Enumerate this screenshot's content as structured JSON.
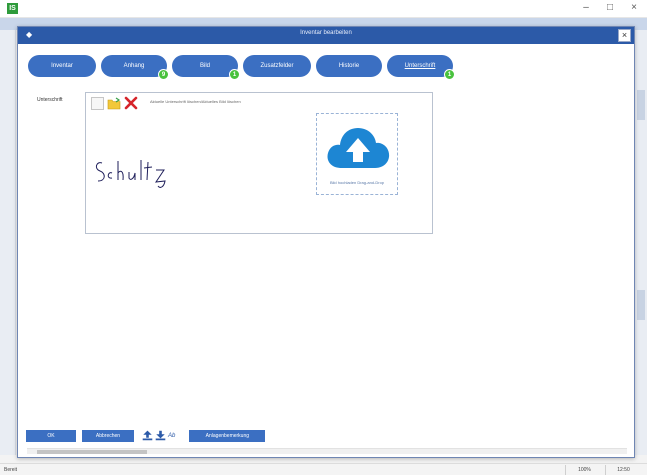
{
  "app": {
    "minimize": "–",
    "maximize": "□",
    "close": "×"
  },
  "dialog": {
    "title": "Inventar bearbeiten",
    "close": "×"
  },
  "tabs": [
    {
      "label": "Inventar",
      "badge": null,
      "active": false
    },
    {
      "label": "Anhang",
      "badge": "9",
      "active": false
    },
    {
      "label": "Bild",
      "badge": "1",
      "active": false
    },
    {
      "label": "Zusatzfelder",
      "badge": null,
      "active": false
    },
    {
      "label": "Historie",
      "badge": null,
      "active": false
    },
    {
      "label": "Unterschrift",
      "badge": "1",
      "active": true
    }
  ],
  "signature": {
    "field_label": "Unterschrift",
    "hint": "Aktuelle Unterschrift löschen/Aktuelles Bild löschen",
    "signature_text": "Schultz",
    "upload_caption": "Bild hochladen Drag-and-Drop"
  },
  "buttons": {
    "ok": "OK",
    "cancel": "Abbrechen",
    "extra": "Ab",
    "attachment": "Anlagenbemerkung"
  },
  "status": {
    "left": "Bereit",
    "zoom": "100%",
    "time": "12:50"
  },
  "colors": {
    "accent": "#3b6fc2",
    "titlebar": "#2c5aa8",
    "badge": "#49c23d",
    "delete": "#d6242a",
    "folder": "#f2c83a",
    "cloud": "#1d86d3"
  },
  "icons": {
    "new": "blank-page-icon",
    "open": "folder-open-icon",
    "delete": "red-x-icon",
    "upload": "cloud-upload-icon",
    "upload_a": "upload-icon",
    "download": "download-icon"
  }
}
